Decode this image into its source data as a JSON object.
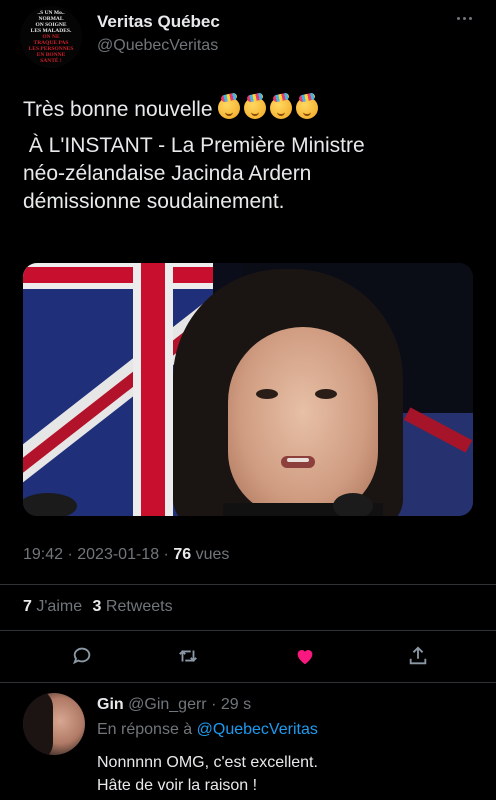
{
  "tweet": {
    "author": {
      "display_name": "Veritas Québec",
      "handle": "@QuebecVeritas",
      "avatar_lines": [
        {
          "text": "..S UN Mo..",
          "color": "#e8e8e8"
        },
        {
          "text": "NORMAL",
          "color": "#e8e8e8"
        },
        {
          "text": "ON SOIGNE",
          "color": "#e8e8e8"
        },
        {
          "text": "LES MALADES.",
          "color": "#e8e8e8"
        },
        {
          "text": "ON NE",
          "color": "#d0202a"
        },
        {
          "text": "TRAQUE PAS",
          "color": "#d0202a"
        },
        {
          "text": "LES PERSONNES",
          "color": "#d0202a"
        },
        {
          "text": "EN BONNE",
          "color": "#d0202a"
        },
        {
          "text": "SANTÉ !",
          "color": "#d0202a"
        }
      ]
    },
    "text_line1": "Très bonne nouvelle",
    "emoji_count": 4,
    "emoji_icon": "partying-face-emoji",
    "text_line2": " À L'INSTANT - La Première Ministre\nnéo-zélandaise Jacinda Ardern\ndémissionne soudainement.",
    "timestamp": "19:42 · 2023-01-18 · ",
    "views_count": "76",
    "views_label": "vues",
    "likes_count": "7",
    "likes_label": "J'aime",
    "retweets_count": "3",
    "retweets_label": "Retweets",
    "actions": [
      {
        "name": "reply-icon"
      },
      {
        "name": "retweet-icon"
      },
      {
        "name": "like-icon",
        "color": "#f91880"
      },
      {
        "name": "share-icon"
      }
    ]
  },
  "reply": {
    "display_name": "Gin",
    "handle": "@Gin_gerr",
    "time": "· 29 s",
    "in_reply_prefix": "En réponse à",
    "in_reply_mention": "@QuebecVeritas",
    "line1": "Nonnnnn OMG, c'est excellent.",
    "line2": "Hâte de voir la raison !"
  },
  "colors": {
    "background": "#000000",
    "text": "#e7e9ea",
    "muted": "#71767b",
    "link": "#1d9bf0",
    "like": "#f91880"
  }
}
